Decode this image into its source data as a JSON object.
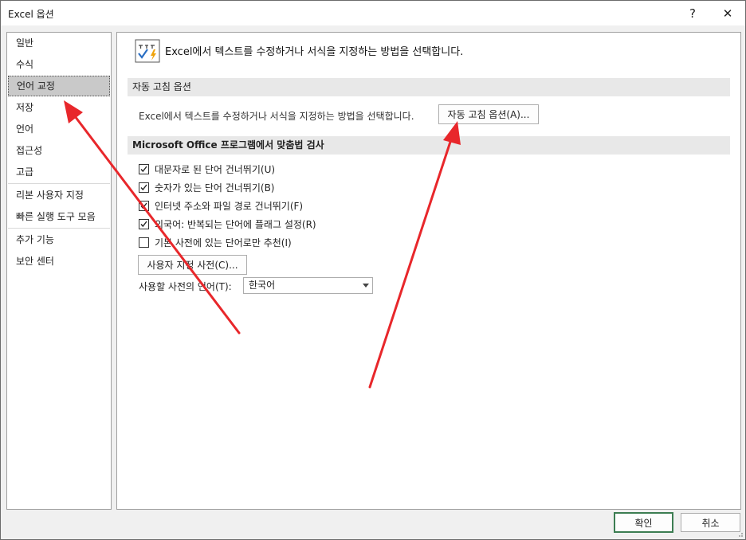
{
  "window": {
    "title": "Excel 옵션",
    "help_label": "?",
    "close_label": "✕"
  },
  "sidebar": {
    "items": [
      {
        "label": "일반"
      },
      {
        "label": "수식"
      },
      {
        "label": "언어 교정",
        "selected": true
      },
      {
        "label": "저장"
      },
      {
        "label": "언어"
      },
      {
        "label": "접근성"
      },
      {
        "label": "고급"
      },
      {
        "label": "리본 사용자 지정"
      },
      {
        "label": "빠른 실행 도구 모음"
      },
      {
        "label": "추가 기능"
      },
      {
        "label": "보안 센터"
      }
    ]
  },
  "main": {
    "header_text": "Excel에서 텍스트를 수정하거나 서식을 지정하는 방법을 선택합니다.",
    "autocorrect_section": {
      "title": "자동 고침 옵션",
      "description": "Excel에서 텍스트를 수정하거나 서식을 지정하는 방법을 선택합니다.",
      "button_label": "자동 고침 옵션(A)..."
    },
    "spelling_section": {
      "title": "Microsoft Office 프로그램에서 맞춤법 검사",
      "checkboxes": [
        {
          "label": "대문자로 된 단어 건너뛰기(U)",
          "checked": true
        },
        {
          "label": "숫자가 있는 단어 건너뛰기(B)",
          "checked": true
        },
        {
          "label": "인터넷 주소와 파일 경로 건너뛰기(F)",
          "checked": true
        },
        {
          "label": "외국어: 반복되는 단어에 플래그 설정(R)",
          "checked": true
        },
        {
          "label": "기본 사전에 있는 단어로만 추천(I)",
          "checked": false
        }
      ],
      "custom_dict_button": "사용자 지정 사전(C)...",
      "dictionary_language_label": "사용할 사전의 언어(T):",
      "dictionary_language_value": "한국어"
    }
  },
  "footer": {
    "ok_label": "확인",
    "cancel_label": "취소"
  },
  "colors": {
    "annotation_arrow": "#e8272b",
    "selected_item_bg": "#c9c9c9",
    "section_bg": "#e8e8e8",
    "ok_border": "#3c7d52"
  }
}
